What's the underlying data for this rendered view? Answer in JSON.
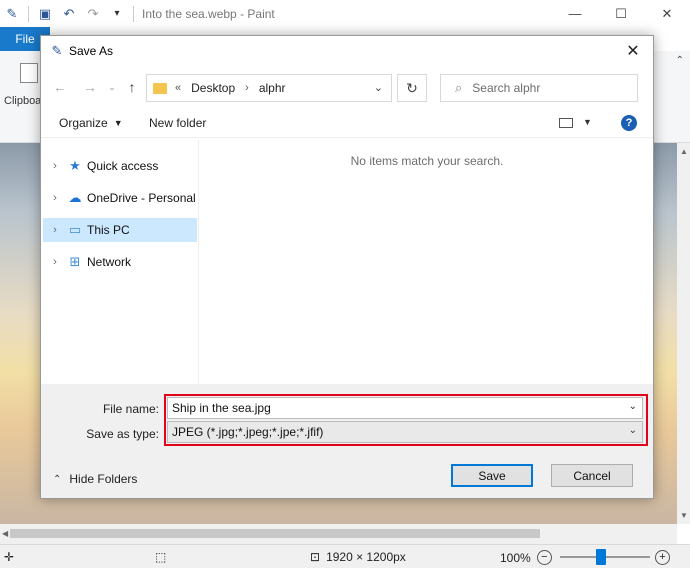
{
  "app": {
    "title": "Into the sea.webp - Paint",
    "file_tab": "File",
    "clipboard_label": "Clipboa",
    "status": {
      "dimensions": "1920 × 1200px",
      "zoom": "100%",
      "zoom_out": "−",
      "zoom_in": "+"
    },
    "window_controls": {
      "minimize": "—",
      "maximize": "☐",
      "close": "✕"
    },
    "accent_color": "#1979ca"
  },
  "dialog": {
    "title": "Save As",
    "close": "✕",
    "address": {
      "prefix": "«",
      "crumbs": [
        "Desktop",
        "alphr"
      ]
    },
    "search": {
      "placeholder": "Search alphr"
    },
    "commands": {
      "organize": "Organize",
      "new_folder": "New folder",
      "help": "?"
    },
    "nav_items": [
      {
        "label": "Quick access",
        "icon": "star-icon",
        "selected": false
      },
      {
        "label": "OneDrive - Personal",
        "icon": "cloud-icon",
        "selected": false
      },
      {
        "label": "This PC",
        "icon": "computer-icon",
        "selected": true
      },
      {
        "label": "Network",
        "icon": "network-icon",
        "selected": false
      }
    ],
    "empty_message": "No items match your search.",
    "file_name_label": "File name:",
    "file_name_value": "Ship in the sea.jpg",
    "save_type_label": "Save as type:",
    "save_type_value": "JPEG (*.jpg;*.jpeg;*.jpe;*.jfif)",
    "hide_folders": "Hide Folders",
    "save_button": "Save",
    "cancel_button": "Cancel",
    "highlight_color": "#e2001a"
  }
}
